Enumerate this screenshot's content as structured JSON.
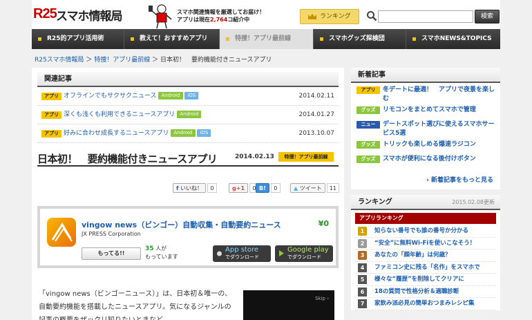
{
  "header": {
    "logo_prefix": "R25",
    "logo_text": "スマホ情報局",
    "tagline_line1": "スマホ関連情報を厳選してお届け！",
    "tagline_line2_a": "アプリは現在",
    "tagline_count": "2,764",
    "tagline_line2_b": "コ紹介中",
    "ranking_label": "ランキング",
    "search_placeholder": "",
    "search_button": "検索"
  },
  "nav": [
    {
      "label": "R25的アプリ活用術"
    },
    {
      "label": "教えて！おすすめアプリ"
    },
    {
      "label": "特捜！アプリ最前線"
    },
    {
      "label": "スマホグッズ探検団"
    },
    {
      "label": "スマホNEWS&TOPICS"
    }
  ],
  "breadcrumb": {
    "home": "R25スマホ情報局",
    "category": "特捜！アプリ最前線",
    "current": "日本初！　要約機能付きニュースアプリ"
  },
  "related": {
    "heading": "関連記事",
    "items": [
      {
        "tag": "アプリ",
        "title": "オフラインでもサクサクニュース",
        "platforms": [
          "Android",
          "iOS"
        ],
        "date": "2014.02.11"
      },
      {
        "tag": "アプリ",
        "title": "深くも浅くも利用できるニュースアプリ",
        "platforms": [
          "Android"
        ],
        "date": "2014.01.27"
      },
      {
        "tag": "アプリ",
        "title": "好みに合わせ成長するニュースアプリ",
        "platforms": [
          "Android",
          "iOS"
        ],
        "date": "2013.10.07"
      }
    ]
  },
  "article": {
    "title": "日本初！　要約機能付きニュースアプリ",
    "date": "2014.02.13",
    "category_badge": "特捜！アプリ最前線",
    "body": "「vingow news（ビンゴーニュース）」は、日本初＆唯一の、自動要約機能を搭載したニュースアプリ。気になるジャンルの記事の概要をザックリ知りたいときなど"
  },
  "social": {
    "facebook_label": "いいね！",
    "facebook_count": "0",
    "gplus_label": "+1",
    "gplus_count": "0",
    "hatena_label": "B!",
    "hatena_count": "0",
    "tweet_label": "ツイート",
    "tweet_count": "11"
  },
  "app": {
    "name": "vingow news（ビンゴー）自動収集・自動要約ニュース",
    "price": "¥0",
    "developer": "JX PRESS Corporation",
    "have_button": "もってる!!",
    "owners_count": "35",
    "owners_unit": "人が",
    "owners_text": "もっています",
    "appstore_small": "App store",
    "appstore_big": "でダウンロード",
    "gplay_small": "Google play",
    "gplay_big": "でダウンロード"
  },
  "video": {
    "skip_label": "Skip ›"
  },
  "sidebar": {
    "new_heading": "新着記事",
    "new_items": [
      {
        "tag": "アプリ",
        "tag_type": "app",
        "title": "冬デートに最適！　アプリで夜景を楽しむ"
      },
      {
        "tag": "グッズ",
        "tag_type": "goods",
        "title": "リモコンをまとめてスマホで管理"
      },
      {
        "tag": "ニュース",
        "tag_type": "news",
        "title": "デートスポット選びに使えるスマホサービス5選"
      },
      {
        "tag": "グッズ",
        "tag_type": "goods",
        "title": "トリックも楽しめる爆速ラジコン"
      },
      {
        "tag": "グッズ",
        "tag_type": "goods",
        "title": "スマホが便利になる後付けボタン"
      }
    ],
    "more_label": "新着記事をもっと見る",
    "ranking_heading": "ランキング",
    "ranking_date": "2015.02.08更新",
    "ranking_tab": "アプリランキング",
    "ranking_items": [
      {
        "rank": "1",
        "title": "知らない番号でも誰の番号か分かる"
      },
      {
        "rank": "2",
        "title": "“安全”に無料Wi-Fiを使いこなそう！"
      },
      {
        "rank": "3",
        "title": "あなたの「顔年齢」は何歳？"
      },
      {
        "rank": "4",
        "title": "ファミコン史に残る「名作」をスマホで"
      },
      {
        "rank": "5",
        "title": "様々な“履歴”を削除してクリアに"
      },
      {
        "rank": "6",
        "title": "18の質問で性格分析＆適職診断"
      },
      {
        "rank": "7",
        "title": "家飲み派必見の簡単おつまみレシピ集"
      }
    ]
  }
}
